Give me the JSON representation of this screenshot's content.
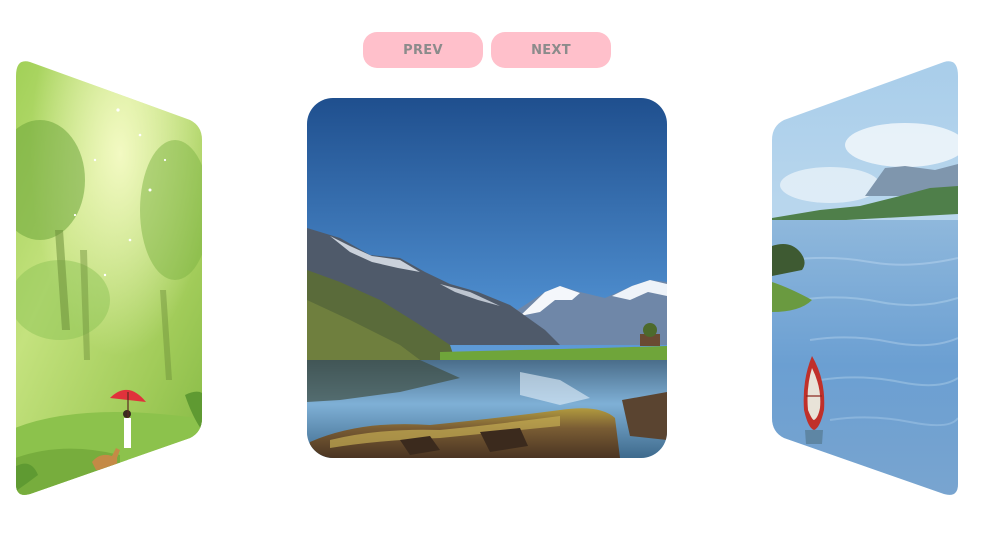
{
  "carousel": {
    "prev_label": "PREV",
    "next_label": "NEXT",
    "slides": [
      {
        "name": "forest-girl-umbrella",
        "position": "left",
        "active": false
      },
      {
        "name": "mountain-lake",
        "position": "center",
        "active": true
      },
      {
        "name": "lake-boat",
        "position": "right",
        "active": false
      }
    ]
  }
}
